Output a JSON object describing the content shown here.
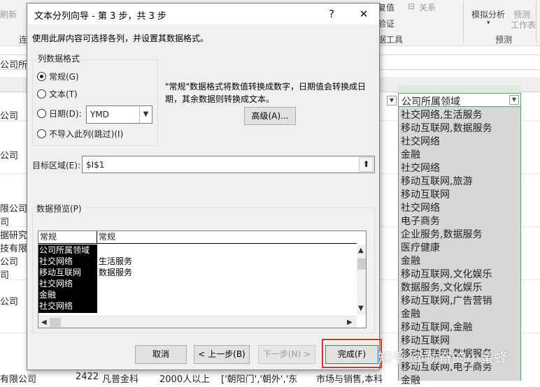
{
  "excel": {
    "ribbon": {
      "refresh": "刷新",
      "data_validation": "复值",
      "relations": "关系",
      "validation": "验证",
      "data_tools": "据工具",
      "what_if": "模拟分析",
      "forecast_sheet": "预测",
      "worksheet": "工作表",
      "forecast_group": "预测",
      "connect": "连"
    },
    "formula_bar_fragment": "公司所",
    "col_i_header": "公司所属领域",
    "col_i_values": [
      "社交网络,生活服务",
      "移动互联网,数据服务",
      "社交网络",
      "金融",
      "社交网络",
      "移动互联网,旅游",
      "移动互联网",
      "社交网络",
      "电子商务",
      "企业服务,数据服务",
      "医疗健康",
      "金融",
      "移动互联网,文化娱乐",
      "数据服务,文化娱乐",
      "移动互联网,广告营销",
      "金融",
      "移动互联网,金融",
      "移动互联网",
      "移动互联网,数据服务",
      "移动互联网,电子商务",
      "金融"
    ],
    "left_cells": {
      "r1": "公司",
      "r2": "公司",
      "r3": "限公司",
      "r4": "司",
      "r5": "据研究",
      "r6": "技有限",
      "r7": "公司",
      "r8": "司",
      "r9": "公司",
      "bottom_row": "有限公司",
      "bottom_num": "2422",
      "bottom_a": "凡普金科",
      "bottom_b": "2000人以上",
      "bottom_c": "['朝阳门','朝外','东",
      "bottom_d": "市场与销售,本科"
    },
    "watermark": "知乎 @勤奋的小蜜蜂"
  },
  "dialog": {
    "title": "文本分列向导 - 第 3 步，共 3 步",
    "help": "?",
    "close": "✕",
    "description": "使用此屏内容可选择各列，并设置其数据格式。",
    "column_format_label": "列数据格式",
    "options": {
      "general": "常规(G)",
      "text": "文本(T)",
      "date": "日期(D):",
      "skip": "不导入此列(跳过)(I)"
    },
    "selected_option": "general",
    "date_format": "YMD",
    "info_text": "\"常规\"数据格式将数值转换成数字，日期值会转换成日期，其余数据则转换成文本。",
    "advanced_button": "高级(A)...",
    "destination_label": "目标区域(E):",
    "destination_value": "$I$1",
    "preview_label": "数据预览(P)",
    "preview": {
      "headers": [
        "常规",
        "常规"
      ],
      "rows": [
        [
          "公司所属领域",
          ""
        ],
        [
          "社交网络",
          "生活服务"
        ],
        [
          "移动互联网",
          "数据服务"
        ],
        [
          "社交网络",
          ""
        ],
        [
          "金融",
          ""
        ],
        [
          "社交网络",
          ""
        ]
      ]
    },
    "buttons": {
      "cancel": "取消",
      "back": "< 上一步(B)",
      "next": "下一步(N) >",
      "finish": "完成(F)"
    },
    "colors": {
      "highlight_border": "#e0302a",
      "selection_fill": "#d7d7d7",
      "selection_border": "#5a9e6f"
    }
  }
}
